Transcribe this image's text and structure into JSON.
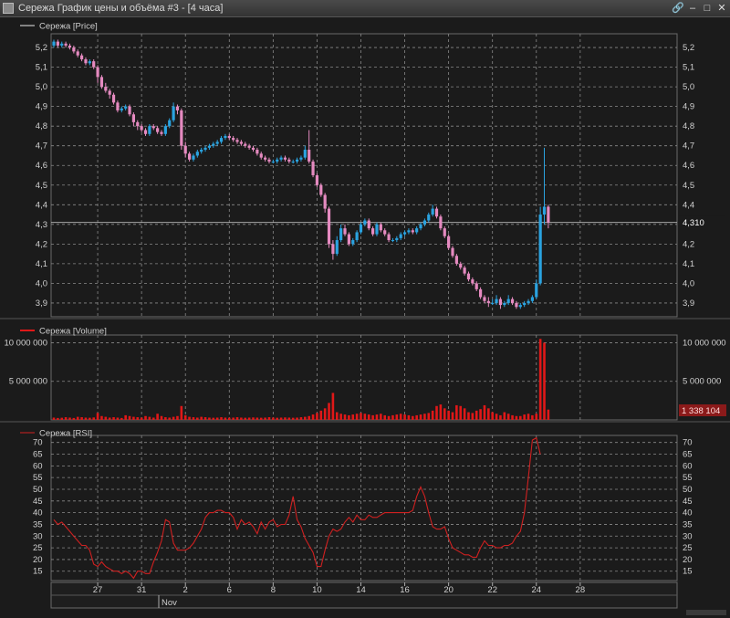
{
  "window": {
    "title": "Сережа График цены и объёма #3 - [4 часа]",
    "link_icon": "link-icon",
    "minimize_icon": "minimize-icon",
    "maximize_icon": "maximize-icon",
    "close_icon": "close-icon"
  },
  "colors": {
    "background": "#1b1b1b",
    "grid": "#8a8a8a",
    "up": "#2aa3e0",
    "down": "#e58ac0",
    "volume": "#e01818",
    "rsi": "#d02020",
    "last_price_bg": "#1b1b1b",
    "last_volume_bg": "#8b1a1a"
  },
  "chart_data": [
    {
      "type": "candlestick",
      "legend": "Сережа [Price]",
      "ylim": [
        3.83,
        5.27
      ],
      "yticks": [
        "5,2",
        "5,1",
        "5,0",
        "4,9",
        "4,8",
        "4,7",
        "4,6",
        "4,5",
        "4,4",
        "4,3",
        "4,2",
        "4,1",
        "4,0",
        "3,9"
      ],
      "last_value_label": "4,310",
      "last_value": 4.31,
      "close": [
        5.23,
        5.21,
        5.22,
        5.21,
        5.2,
        5.18,
        5.16,
        5.14,
        5.12,
        5.13,
        5.1,
        5.05,
        5.0,
        4.98,
        4.96,
        4.92,
        4.88,
        4.89,
        4.9,
        4.86,
        4.82,
        4.8,
        4.78,
        4.76,
        4.8,
        4.79,
        4.77,
        4.76,
        4.8,
        4.83,
        4.9,
        4.88,
        4.7,
        4.66,
        4.63,
        4.65,
        4.67,
        4.68,
        4.69,
        4.7,
        4.71,
        4.72,
        4.74,
        4.75,
        4.74,
        4.73,
        4.72,
        4.71,
        4.7,
        4.69,
        4.68,
        4.66,
        4.64,
        4.63,
        4.62,
        4.62,
        4.63,
        4.64,
        4.63,
        4.62,
        4.62,
        4.63,
        4.64,
        4.68,
        4.62,
        4.55,
        4.5,
        4.45,
        4.38,
        4.2,
        4.15,
        4.22,
        4.28,
        4.25,
        4.2,
        4.22,
        4.26,
        4.3,
        4.32,
        4.28,
        4.25,
        4.3,
        4.27,
        4.25,
        4.22,
        4.22,
        4.23,
        4.25,
        4.26,
        4.27,
        4.26,
        4.28,
        4.3,
        4.32,
        4.35,
        4.38,
        4.34,
        4.28,
        4.24,
        4.18,
        4.14,
        4.1,
        4.08,
        4.05,
        4.02,
        4.0,
        3.97,
        3.93,
        3.91,
        3.9,
        3.9,
        3.92,
        3.89,
        3.9,
        3.92,
        3.9,
        3.88,
        3.89,
        3.9,
        3.91,
        3.93,
        4.0,
        4.35,
        4.39,
        4.31
      ],
      "open": [
        5.21,
        5.23,
        5.21,
        5.22,
        5.21,
        5.2,
        5.18,
        5.16,
        5.14,
        5.12,
        5.13,
        5.1,
        5.05,
        5.0,
        4.98,
        4.96,
        4.92,
        4.88,
        4.89,
        4.9,
        4.86,
        4.82,
        4.8,
        4.78,
        4.76,
        4.8,
        4.79,
        4.77,
        4.76,
        4.8,
        4.83,
        4.9,
        4.88,
        4.7,
        4.66,
        4.63,
        4.65,
        4.67,
        4.68,
        4.69,
        4.7,
        4.71,
        4.72,
        4.74,
        4.75,
        4.74,
        4.73,
        4.72,
        4.71,
        4.7,
        4.69,
        4.68,
        4.66,
        4.64,
        4.63,
        4.62,
        4.62,
        4.63,
        4.64,
        4.63,
        4.62,
        4.62,
        4.63,
        4.64,
        4.68,
        4.62,
        4.55,
        4.5,
        4.45,
        4.38,
        4.2,
        4.15,
        4.22,
        4.28,
        4.25,
        4.2,
        4.22,
        4.26,
        4.3,
        4.32,
        4.28,
        4.25,
        4.3,
        4.27,
        4.25,
        4.22,
        4.22,
        4.23,
        4.25,
        4.26,
        4.27,
        4.26,
        4.28,
        4.3,
        4.32,
        4.35,
        4.38,
        4.34,
        4.28,
        4.24,
        4.18,
        4.14,
        4.1,
        4.08,
        4.05,
        4.02,
        4.0,
        3.97,
        3.93,
        3.91,
        3.9,
        3.9,
        3.92,
        3.89,
        3.9,
        3.92,
        3.9,
        3.88,
        3.89,
        3.9,
        3.91,
        3.93,
        4.0,
        4.35,
        4.39
      ],
      "high": [
        5.24,
        5.24,
        5.23,
        5.23,
        5.22,
        5.21,
        5.19,
        5.17,
        5.15,
        5.14,
        5.14,
        5.11,
        5.06,
        5.02,
        4.99,
        4.97,
        4.93,
        4.9,
        4.91,
        4.91,
        4.87,
        4.83,
        4.81,
        4.79,
        4.81,
        4.81,
        4.8,
        4.78,
        4.81,
        4.84,
        4.92,
        4.91,
        4.89,
        4.72,
        4.67,
        4.66,
        4.68,
        4.69,
        4.7,
        4.71,
        4.72,
        4.73,
        4.75,
        4.76,
        4.76,
        4.75,
        4.74,
        4.73,
        4.72,
        4.71,
        4.7,
        4.69,
        4.67,
        4.65,
        4.64,
        4.63,
        4.64,
        4.65,
        4.65,
        4.64,
        4.63,
        4.64,
        4.65,
        4.7,
        4.78,
        4.63,
        4.56,
        4.51,
        4.46,
        4.39,
        4.22,
        4.24,
        4.3,
        4.3,
        4.26,
        4.23,
        4.27,
        4.31,
        4.33,
        4.33,
        4.29,
        4.31,
        4.31,
        4.28,
        4.26,
        4.23,
        4.24,
        4.26,
        4.27,
        4.28,
        4.28,
        4.29,
        4.31,
        4.33,
        4.36,
        4.4,
        4.39,
        4.35,
        4.29,
        4.25,
        4.19,
        4.15,
        4.11,
        4.09,
        4.06,
        4.03,
        4.01,
        3.98,
        3.94,
        3.93,
        3.92,
        3.94,
        3.93,
        3.91,
        3.94,
        3.93,
        3.91,
        3.9,
        3.91,
        3.92,
        3.94,
        4.02,
        4.39,
        4.69,
        4.4
      ],
      "low": [
        5.2,
        5.2,
        5.2,
        5.2,
        5.19,
        5.17,
        5.15,
        5.13,
        5.11,
        5.11,
        5.09,
        5.02,
        4.99,
        4.97,
        4.94,
        4.91,
        4.87,
        4.87,
        4.88,
        4.85,
        4.8,
        4.78,
        4.77,
        4.75,
        4.75,
        4.78,
        4.76,
        4.75,
        4.75,
        4.79,
        4.82,
        4.86,
        4.68,
        4.64,
        4.62,
        4.62,
        4.64,
        4.66,
        4.67,
        4.68,
        4.69,
        4.7,
        4.71,
        4.73,
        4.73,
        4.72,
        4.71,
        4.7,
        4.69,
        4.68,
        4.67,
        4.65,
        4.63,
        4.62,
        4.61,
        4.61,
        4.61,
        4.62,
        4.62,
        4.61,
        4.61,
        4.61,
        4.62,
        4.63,
        4.61,
        4.54,
        4.49,
        4.44,
        4.36,
        4.18,
        4.12,
        4.14,
        4.21,
        4.24,
        4.19,
        4.19,
        4.21,
        4.25,
        4.29,
        4.27,
        4.24,
        4.24,
        4.26,
        4.24,
        4.21,
        4.21,
        4.21,
        4.22,
        4.24,
        4.25,
        4.25,
        4.25,
        4.27,
        4.29,
        4.31,
        4.34,
        4.33,
        4.27,
        4.23,
        4.17,
        4.13,
        4.09,
        4.07,
        4.04,
        4.01,
        3.99,
        3.96,
        3.92,
        3.9,
        3.88,
        3.89,
        3.89,
        3.87,
        3.88,
        3.89,
        3.89,
        3.87,
        3.87,
        3.88,
        3.89,
        3.9,
        3.92,
        3.99,
        4.3,
        4.28
      ]
    },
    {
      "type": "bar",
      "legend": "Сережа [Volume]",
      "ylim": [
        0,
        11000000
      ],
      "yticks": [
        "10 000 000",
        "5 000 000"
      ],
      "ytick_values": [
        10000000,
        5000000
      ],
      "last_value_label": "1 338 104",
      "values": [
        300000,
        250000,
        280000,
        350000,
        300000,
        250000,
        400000,
        350000,
        300000,
        280000,
        320000,
        900000,
        500000,
        400000,
        300000,
        350000,
        300000,
        250000,
        600000,
        500000,
        400000,
        350000,
        300000,
        500000,
        400000,
        300000,
        800000,
        500000,
        350000,
        300000,
        400000,
        500000,
        1800000,
        600000,
        400000,
        350000,
        300000,
        400000,
        350000,
        300000,
        280000,
        300000,
        350000,
        300000,
        280000,
        300000,
        350000,
        300000,
        280000,
        300000,
        320000,
        300000,
        280000,
        300000,
        350000,
        300000,
        280000,
        300000,
        320000,
        300000,
        280000,
        300000,
        350000,
        400000,
        500000,
        700000,
        900000,
        1200000,
        1500000,
        2200000,
        3500000,
        1000000,
        800000,
        700000,
        600000,
        700000,
        800000,
        900000,
        800000,
        700000,
        600000,
        700000,
        800000,
        600000,
        500000,
        600000,
        700000,
        800000,
        700000,
        600000,
        500000,
        600000,
        700000,
        800000,
        900000,
        1200000,
        1800000,
        2000000,
        1500000,
        1200000,
        1000000,
        1900000,
        1800000,
        1500000,
        1000000,
        900000,
        1200000,
        1400000,
        1900000,
        1500000,
        1000000,
        800000,
        600000,
        1000000,
        800000,
        600000,
        500000,
        500000,
        700000,
        800000,
        600000,
        800000,
        10500000,
        10000000,
        1338104
      ]
    },
    {
      "type": "line",
      "legend": "Сережа [RSI]",
      "ylim": [
        11,
        73
      ],
      "yticks": [
        "70",
        "65",
        "60",
        "55",
        "50",
        "45",
        "40",
        "35",
        "30",
        "25",
        "20",
        "15"
      ],
      "ytick_values": [
        70,
        65,
        60,
        55,
        50,
        45,
        40,
        35,
        30,
        25,
        20,
        15
      ],
      "values": [
        37,
        35,
        36,
        34,
        32,
        30,
        28,
        26,
        26,
        24,
        18,
        17,
        19,
        17,
        16,
        15,
        15,
        14,
        15,
        14,
        12,
        15,
        15,
        14,
        14,
        19,
        23,
        28,
        37,
        36,
        27,
        24,
        24,
        24,
        25,
        27,
        30,
        33,
        38,
        40,
        40,
        41,
        41,
        40,
        40,
        38,
        33,
        37,
        35,
        36,
        34,
        31,
        36,
        33,
        36,
        37,
        34,
        35,
        35,
        39,
        47,
        37,
        34,
        29,
        26,
        23,
        17,
        17,
        24,
        30,
        33,
        32,
        33,
        36,
        38,
        36,
        39,
        37,
        37,
        39,
        38,
        38,
        39,
        40,
        40,
        40,
        40,
        40,
        40,
        40,
        41,
        47,
        51,
        47,
        40,
        34,
        33,
        33,
        34,
        29,
        25,
        24,
        23,
        22,
        22,
        21,
        21,
        25,
        28,
        26,
        26,
        25,
        25,
        26,
        26,
        27,
        30,
        32,
        40,
        55,
        71,
        72,
        65
      ]
    }
  ],
  "x_axis": {
    "labels": [
      "27",
      "31",
      "2",
      "6",
      "8",
      "10",
      "14",
      "16",
      "20",
      "22",
      "24",
      "28"
    ],
    "label_positions": [
      11,
      22,
      33,
      44,
      55,
      66,
      77,
      88,
      99,
      110,
      121,
      132
    ],
    "month_label": "Nov",
    "month_position": 27
  }
}
